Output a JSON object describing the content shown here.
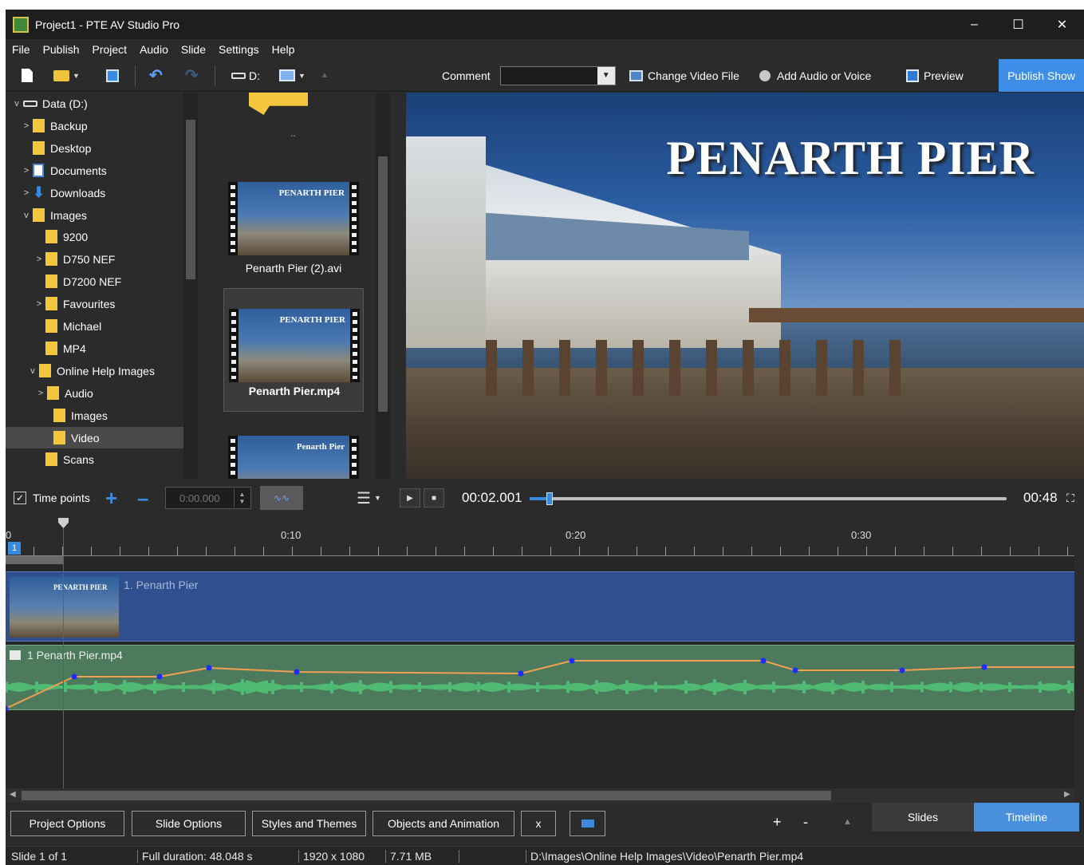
{
  "window": {
    "title": "Project1 - PTE AV Studio Pro",
    "controls": [
      "–",
      "☐",
      "✕"
    ]
  },
  "menu": [
    "File",
    "Publish",
    "Project",
    "Audio",
    "Slide",
    "Settings",
    "Help"
  ],
  "toolbar": {
    "drive_label": "D:",
    "comment_label": "Comment",
    "comment_value": "",
    "change_video_label": "Change Video File",
    "add_audio_label": "Add Audio or Voice",
    "preview_label": "Preview",
    "publish_label": "Publish Show"
  },
  "tree": {
    "drive": "Data (D:)",
    "items": [
      {
        "label": "Backup",
        "expand": ">"
      },
      {
        "label": "Desktop",
        "expand": ""
      },
      {
        "label": "Documents",
        "expand": ">"
      },
      {
        "label": "Downloads",
        "expand": ">"
      },
      {
        "label": "Images",
        "expand": "v"
      },
      {
        "label": "9200",
        "expand": ""
      },
      {
        "label": "D750 NEF",
        "expand": ">"
      },
      {
        "label": "D7200 NEF",
        "expand": ""
      },
      {
        "label": "Favourites",
        "expand": ">"
      },
      {
        "label": "Michael",
        "expand": ""
      },
      {
        "label": "MP4",
        "expand": ""
      },
      {
        "label": "Online Help Images",
        "expand": "v"
      },
      {
        "label": "Audio",
        "expand": ">"
      },
      {
        "label": "Images",
        "expand": ""
      },
      {
        "label": "Video",
        "expand": ""
      },
      {
        "label": "Scans",
        "expand": ""
      }
    ]
  },
  "files": {
    "parent": "..",
    "items": [
      {
        "name": "Penarth Pier (2).avi",
        "thumb_title": "PENARTH PIER"
      },
      {
        "name": "Penarth Pier.mp4",
        "thumb_title": "PENARTH PIER"
      },
      {
        "name": "",
        "thumb_title": "Penarth Pier"
      }
    ]
  },
  "preview": {
    "title": "PENARTH PIER"
  },
  "playback": {
    "time_points_label": "Time points",
    "time_points_checked": true,
    "time_input": "0:00.000",
    "current_time": "00:02.001",
    "total_time": "00:48",
    "progress": 0.042
  },
  "timeline": {
    "ruler_labels": [
      "0",
      "0:10",
      "0:20",
      "0:30"
    ],
    "slide_number": "1",
    "slide_track_label": "1. Penarth Pier",
    "slide_thumb_title": "PENARTH PIER",
    "audio_track_label": "1  Penarth Pier.mp4"
  },
  "bottom_buttons": {
    "project_options": "Project Options",
    "slide_options": "Slide Options",
    "styles_themes": "Styles and Themes",
    "objects_animation": "Objects and Animation",
    "x_label": "x",
    "plus": "+",
    "minus": "-",
    "tab_slides": "Slides",
    "tab_timeline": "Timeline"
  },
  "status": {
    "slide": "Slide 1 of 1",
    "duration": "Full duration: 48.048 s",
    "resolution": "1920 x 1080",
    "size": "7.71 MB",
    "path": "D:\\Images\\Online Help Images\\Video\\Penarth Pier.mp4"
  },
  "colors": {
    "accent": "#3d8ee6",
    "slide_track": "#2f4f8f",
    "audio_track": "#4d7a5d",
    "envelope": "#f0a050",
    "playhead": "#d03030"
  }
}
